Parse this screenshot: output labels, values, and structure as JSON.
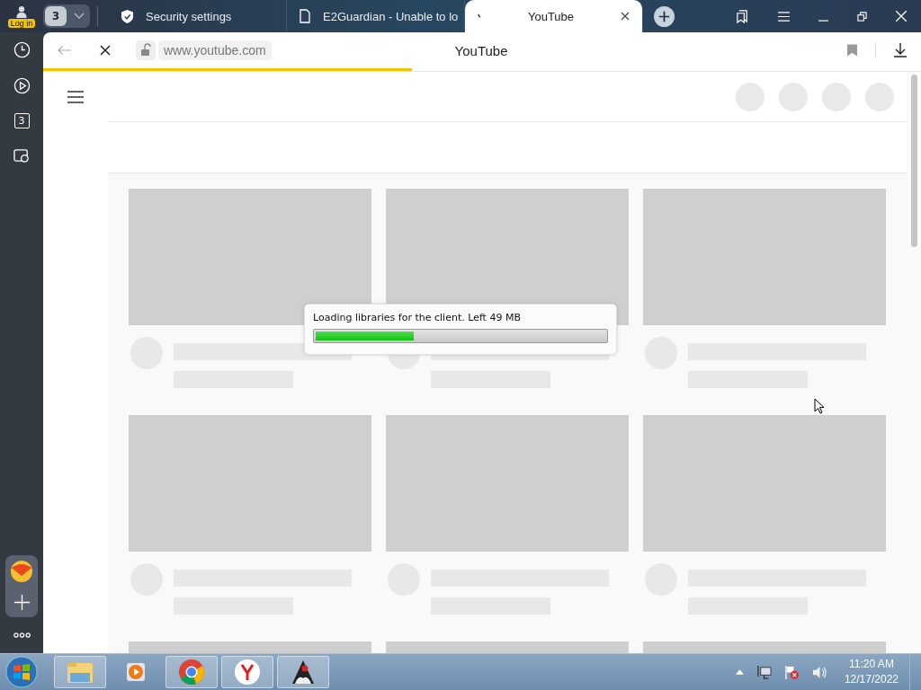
{
  "account": {
    "label": "Log in"
  },
  "tab_counter": "3",
  "tabs": [
    {
      "title": "Security settings",
      "selected": false,
      "kind": "shield"
    },
    {
      "title": "E2Guardian - Unable to lo",
      "selected": false,
      "kind": "page"
    },
    {
      "title": "YouTube",
      "selected": true,
      "kind": "loading"
    }
  ],
  "address_bar": {
    "url": "www.youtube.com",
    "page_title": "YouTube",
    "load_bar": {
      "level": 0.42
    }
  },
  "sidebar": {
    "tabs_count": "3"
  },
  "loading_dialog": {
    "message": "Loading libraries for the client. Left 49 MB",
    "level": 0.34
  },
  "taskbar": {
    "time": "11:20 AM",
    "date": "12/17/2022"
  }
}
